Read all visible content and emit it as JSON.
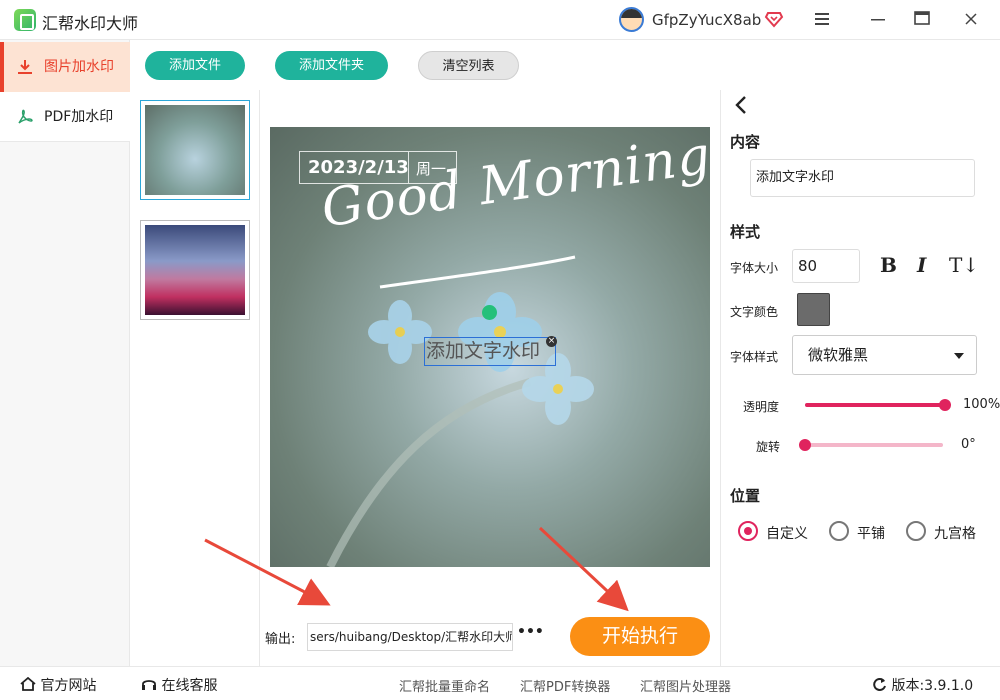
{
  "app": {
    "title": "汇帮水印大师"
  },
  "user": {
    "name": "GfpZyYucX8ab"
  },
  "nav": {
    "image_watermark": "图片加水印",
    "pdf_watermark": "PDF加水印"
  },
  "toolbar": {
    "add_file": "添加文件",
    "add_folder": "添加文件夹",
    "clear_list": "清空列表"
  },
  "preview": {
    "date": "2023/2/13",
    "weekday": "周一",
    "greeting": "Good Morning!",
    "watermark_text": "添加文字水印"
  },
  "output": {
    "label": "输出:",
    "path": "sers/huibang/Desktop/汇帮水印大师",
    "more": "•••",
    "start": "开始执行"
  },
  "panel": {
    "content_title": "内容",
    "content_value": "添加文字水印",
    "style_title": "样式",
    "font_size_label": "字体大小",
    "font_size": "80",
    "bold": "B",
    "italic": "I",
    "text_height": "T↓",
    "text_color_label": "文字颜色",
    "text_color": "#6b6b6b",
    "font_style_label": "字体样式",
    "font_style": "微软雅黑",
    "opacity_label": "透明度",
    "opacity_value": "100%",
    "opacity_fraction": 1.0,
    "rotation_label": "旋转",
    "rotation_value": "0°",
    "rotation_fraction": 0.0,
    "position_title": "位置",
    "pos_custom": "自定义",
    "pos_tile": "平铺",
    "pos_grid": "九宫格"
  },
  "statusbar": {
    "website": "官方网站",
    "support": "在线客服",
    "link1": "汇帮批量重命名",
    "link2": "汇帮PDF转换器",
    "link3": "汇帮图片处理器",
    "version": "版本:3.9.1.0"
  },
  "colors": {
    "accent": "#e0245e",
    "teal": "#1fb39c",
    "orange": "#fb8f14",
    "nav_active": "#e8412c"
  }
}
